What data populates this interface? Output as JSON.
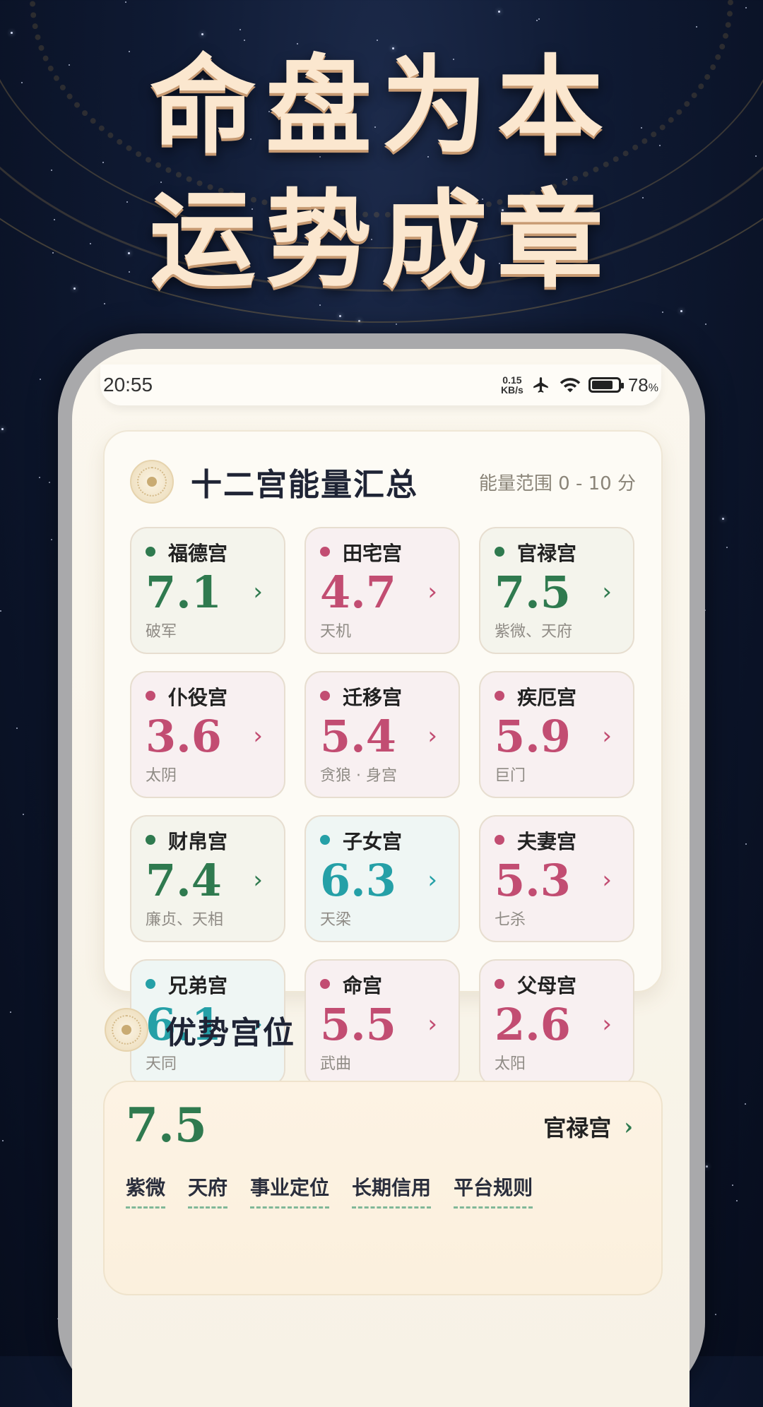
{
  "headline": {
    "line1": "命盘为本",
    "line2": "运势成章"
  },
  "status": {
    "time": "20:55",
    "net_value": "0.15",
    "net_unit": "KB/s",
    "battery": "78",
    "battery_unit": "%"
  },
  "summary": {
    "title": "十二宫能量汇总",
    "range": "能量范围 0 - 10 分",
    "palaces": [
      {
        "name": "福德宫",
        "score": "7.1",
        "stars": "破军",
        "tone": "green"
      },
      {
        "name": "田宅宫",
        "score": "4.7",
        "stars": "天机",
        "tone": "pink"
      },
      {
        "name": "官禄宫",
        "score": "7.5",
        "stars": "紫微、天府",
        "tone": "green"
      },
      {
        "name": "仆役宫",
        "score": "3.6",
        "stars": "太阴",
        "tone": "pink"
      },
      {
        "name": "迁移宫",
        "score": "5.4",
        "stars": "贪狼 · 身宫",
        "tone": "pink"
      },
      {
        "name": "疾厄宫",
        "score": "5.9",
        "stars": "巨门",
        "tone": "pink"
      },
      {
        "name": "财帛宫",
        "score": "7.4",
        "stars": "廉贞、天相",
        "tone": "green"
      },
      {
        "name": "子女宫",
        "score": "6.3",
        "stars": "天梁",
        "tone": "teal"
      },
      {
        "name": "夫妻宫",
        "score": "5.3",
        "stars": "七杀",
        "tone": "pink"
      },
      {
        "name": "兄弟宫",
        "score": "6.1",
        "stars": "天同",
        "tone": "teal"
      },
      {
        "name": "命宫",
        "score": "5.5",
        "stars": "武曲",
        "tone": "pink"
      },
      {
        "name": "父母宫",
        "score": "2.6",
        "stars": "太阳",
        "tone": "pink"
      }
    ],
    "chevron": "›"
  },
  "advantage": {
    "title": "优势宫位",
    "score": "7.5",
    "palace": "官禄宫",
    "chevron": "›",
    "tags": [
      "紫微",
      "天府",
      "事业定位",
      "长期信用",
      "平台规则"
    ]
  },
  "colors": {
    "green": "#2f7a4f",
    "pink": "#c24d72",
    "teal": "#25a0a7",
    "headline": "#fbe7cf"
  }
}
